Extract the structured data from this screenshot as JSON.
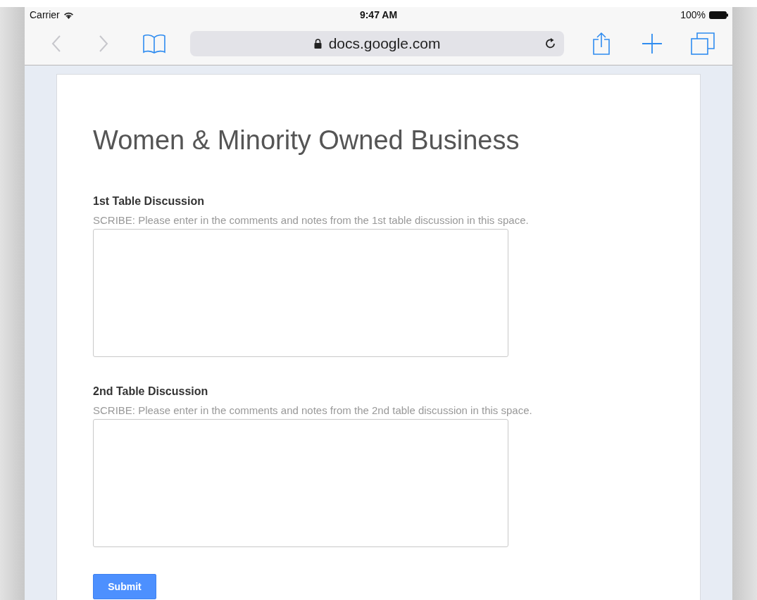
{
  "status_bar": {
    "carrier": "Carrier",
    "time": "9:47 AM",
    "battery": "100%"
  },
  "browser": {
    "url": "docs.google.com"
  },
  "form": {
    "title": "Women & Minority Owned Business",
    "questions": [
      {
        "label": "1st Table Discussion",
        "description": "SCRIBE: Please enter in the comments and notes from the 1st table discussion in this space."
      },
      {
        "label": "2nd Table Discussion",
        "description": "SCRIBE: Please enter in the comments and notes from the 2nd table discussion in this space."
      }
    ],
    "submit": "Submit"
  }
}
